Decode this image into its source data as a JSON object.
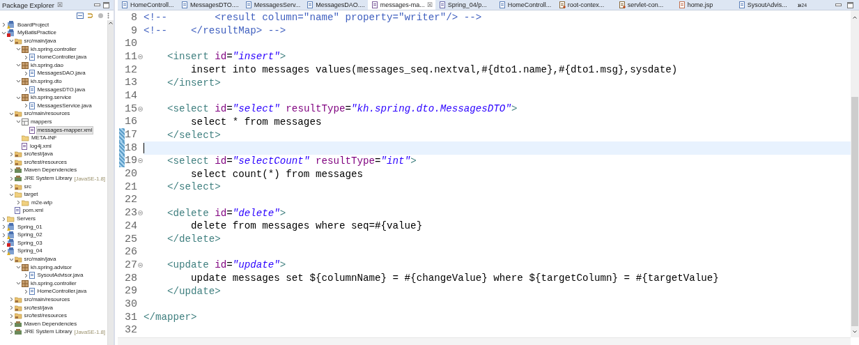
{
  "explorer": {
    "title": "Package Explorer",
    "close": "☒",
    "tree": [
      {
        "label": "BoardProject",
        "kind": "project",
        "error": false,
        "expanded": false,
        "selected": false
      },
      {
        "label": "MyBatisPractice",
        "kind": "project",
        "error": true,
        "expanded": true,
        "selected": false,
        "children": [
          {
            "label": "src/main/java",
            "kind": "source",
            "expanded": true,
            "selected": false,
            "children": [
              {
                "label": "kh.spring.controller",
                "kind": "package",
                "expanded": true,
                "selected": false,
                "children": [
                  {
                    "label": "HomeController.java",
                    "kind": "java",
                    "expanded": false,
                    "selected": false
                  }
                ]
              },
              {
                "label": "kh.spring.dao",
                "kind": "package",
                "expanded": true,
                "selected": false,
                "children": [
                  {
                    "label": "MessagesDAO.java",
                    "kind": "java",
                    "expanded": false,
                    "selected": false
                  }
                ]
              },
              {
                "label": "kh.spring.dto",
                "kind": "package",
                "expanded": true,
                "selected": false,
                "children": [
                  {
                    "label": "MessagesDTO.java",
                    "kind": "java",
                    "expanded": false,
                    "selected": false
                  }
                ]
              },
              {
                "label": "kh.spring.service",
                "kind": "package",
                "expanded": true,
                "selected": false,
                "children": [
                  {
                    "label": "MessagesService.java",
                    "kind": "java",
                    "expanded": false,
                    "selected": false
                  }
                ]
              }
            ]
          },
          {
            "label": "src/main/resources",
            "kind": "source",
            "expanded": true,
            "selected": false,
            "children": [
              {
                "label": "mappers",
                "kind": "mappers",
                "expanded": true,
                "selected": false,
                "children": [
                  {
                    "label": "messages-mapper.xml",
                    "kind": "xml",
                    "selected": true
                  }
                ]
              },
              {
                "label": "META-INF",
                "kind": "folder",
                "selected": false
              },
              {
                "label": "log4j.xml",
                "kind": "xml",
                "selected": false
              }
            ]
          },
          {
            "label": "src/test/java",
            "kind": "source",
            "expanded": false,
            "selected": false
          },
          {
            "label": "src/test/resources",
            "kind": "source",
            "expanded": false,
            "selected": false
          },
          {
            "label": "Maven Dependencies",
            "kind": "library",
            "expanded": false,
            "selected": false
          },
          {
            "label": "JRE System Library",
            "decoration": "[JavaSE-1.8]",
            "kind": "library",
            "expanded": false,
            "selected": false
          },
          {
            "label": "src",
            "kind": "source",
            "expanded": false,
            "selected": false
          },
          {
            "label": "target",
            "kind": "folder",
            "expanded": true,
            "selected": false,
            "children": [
              {
                "label": "m2e-wtp",
                "kind": "folder",
                "expanded": false,
                "selected": false
              }
            ]
          },
          {
            "label": "pom.xml",
            "kind": "pom",
            "selected": false
          }
        ]
      },
      {
        "label": "Servers",
        "kind": "folder",
        "expanded": false,
        "selected": false
      },
      {
        "label": "Spring_01",
        "kind": "project",
        "error": false,
        "expanded": false,
        "selected": false
      },
      {
        "label": "Spring_02",
        "kind": "project",
        "error": false,
        "expanded": false,
        "selected": false
      },
      {
        "label": "Spring_03",
        "kind": "project",
        "error": true,
        "expanded": false,
        "selected": false
      },
      {
        "label": "Spring_04",
        "kind": "project",
        "error": false,
        "expanded": true,
        "selected": false,
        "children": [
          {
            "label": "src/main/java",
            "kind": "source",
            "expanded": true,
            "selected": false,
            "children": [
              {
                "label": "kh.spring.advisor",
                "kind": "package",
                "expanded": true,
                "selected": false,
                "children": [
                  {
                    "label": "SysoutAdvisor.java",
                    "kind": "java",
                    "expanded": false,
                    "selected": false
                  }
                ]
              },
              {
                "label": "kh.spring.controller",
                "kind": "package",
                "expanded": true,
                "selected": false,
                "children": [
                  {
                    "label": "HomeController.java",
                    "kind": "java",
                    "expanded": false,
                    "selected": false
                  }
                ]
              }
            ]
          },
          {
            "label": "src/main/resources",
            "kind": "source",
            "expanded": false,
            "selected": false
          },
          {
            "label": "src/test/java",
            "kind": "source",
            "expanded": false,
            "selected": false
          },
          {
            "label": "src/test/resources",
            "kind": "source",
            "expanded": false,
            "selected": false
          },
          {
            "label": "Maven Dependencies",
            "kind": "library",
            "expanded": false,
            "selected": false
          },
          {
            "label": "JRE System Library",
            "decoration": "[JavaSE-1.8]",
            "kind": "library",
            "expanded": false,
            "selected": false
          }
        ]
      }
    ]
  },
  "editor": {
    "tabs": [
      {
        "label": "HomeControll...",
        "kind": "java",
        "selected": false
      },
      {
        "label": "MessagesDTO....",
        "kind": "java",
        "selected": false
      },
      {
        "label": "MessagesServ...",
        "kind": "java",
        "selected": false
      },
      {
        "label": "MessagesDAO....",
        "kind": "java",
        "selected": false
      },
      {
        "label": "messages-ma...",
        "kind": "xml",
        "selected": true,
        "close": "☒"
      },
      {
        "label": "Spring_04/p...",
        "kind": "pom",
        "selected": false
      },
      {
        "label": "HomeControll...",
        "kind": "java",
        "selected": false
      },
      {
        "label": "root-contex...",
        "kind": "spring",
        "selected": false
      },
      {
        "label": "servlet-con...",
        "kind": "spring",
        "selected": false
      },
      {
        "label": "home.jsp",
        "kind": "jsp",
        "selected": false
      },
      {
        "label": "SysoutAdvis...",
        "kind": "java",
        "selected": false
      }
    ],
    "overflow": "»",
    "overflow_count": "24",
    "lines": [
      {
        "number": "8",
        "segments": [
          {
            "kind": "comment",
            "text": "<!--        <result column=\"name\" property=\"writer\"/> -->"
          }
        ]
      },
      {
        "number": "9",
        "segments": [
          {
            "kind": "comment",
            "text": "<!--    </resultMap> -->"
          }
        ]
      },
      {
        "number": "10"
      },
      {
        "number": "11",
        "fold": true,
        "segments": [
          {
            "kind": "tag",
            "text": "    <insert"
          },
          {
            "kind": "attr",
            "text": " id"
          },
          {
            "kind": "text",
            "text": "="
          },
          {
            "kind": "string",
            "text": "\"insert\""
          },
          {
            "kind": "tag",
            "text": ">"
          }
        ]
      },
      {
        "number": "12",
        "segments": [
          {
            "kind": "text",
            "text": "        insert into messages values(messages_seq.nextval,#{dto1.name},#{dto1.msg},sysdate)"
          }
        ]
      },
      {
        "number": "13",
        "segments": [
          {
            "kind": "tag",
            "text": "    </insert>"
          }
        ]
      },
      {
        "number": "14"
      },
      {
        "number": "15",
        "fold": true,
        "segments": [
          {
            "kind": "tag",
            "text": "    <select"
          },
          {
            "kind": "attr",
            "text": " id"
          },
          {
            "kind": "text",
            "text": "="
          },
          {
            "kind": "string",
            "text": "\"select\""
          },
          {
            "kind": "attr",
            "text": " resultType"
          },
          {
            "kind": "text",
            "text": "="
          },
          {
            "kind": "string",
            "text": "\"kh.spring.dto.MessagesDTO\""
          },
          {
            "kind": "tag",
            "text": ">"
          }
        ]
      },
      {
        "number": "16",
        "segments": [
          {
            "kind": "text",
            "text": "        select * from messages"
          }
        ]
      },
      {
        "number": "17",
        "changed": true,
        "segments": [
          {
            "kind": "tag",
            "text": "    </select>"
          }
        ]
      },
      {
        "number": "18",
        "changed": true,
        "current": true
      },
      {
        "number": "19",
        "changed": true,
        "fold": true,
        "segments": [
          {
            "kind": "tag",
            "text": "    <select"
          },
          {
            "kind": "attr",
            "text": " id"
          },
          {
            "kind": "text",
            "text": "="
          },
          {
            "kind": "string",
            "text": "\"selectCount\""
          },
          {
            "kind": "attr",
            "text": " resultType"
          },
          {
            "kind": "text",
            "text": "="
          },
          {
            "kind": "string",
            "text": "\"int\""
          },
          {
            "kind": "tag",
            "text": ">"
          }
        ]
      },
      {
        "number": "20",
        "segments": [
          {
            "kind": "text",
            "text": "        select count(*) from messages"
          }
        ]
      },
      {
        "number": "21",
        "segments": [
          {
            "kind": "tag",
            "text": "    </select>"
          }
        ]
      },
      {
        "number": "22"
      },
      {
        "number": "23",
        "fold": true,
        "segments": [
          {
            "kind": "tag",
            "text": "    <delete"
          },
          {
            "kind": "attr",
            "text": " id"
          },
          {
            "kind": "text",
            "text": "="
          },
          {
            "kind": "string",
            "text": "\"delete\""
          },
          {
            "kind": "tag",
            "text": ">"
          }
        ]
      },
      {
        "number": "24",
        "segments": [
          {
            "kind": "text",
            "text": "        delete from messages where seq=#{value}"
          }
        ]
      },
      {
        "number": "25",
        "segments": [
          {
            "kind": "tag",
            "text": "    </delete>"
          }
        ]
      },
      {
        "number": "26"
      },
      {
        "number": "27",
        "fold": true,
        "segments": [
          {
            "kind": "tag",
            "text": "    <update"
          },
          {
            "kind": "attr",
            "text": " id"
          },
          {
            "kind": "text",
            "text": "="
          },
          {
            "kind": "string",
            "text": "\"update\""
          },
          {
            "kind": "tag",
            "text": ">"
          }
        ]
      },
      {
        "number": "28",
        "segments": [
          {
            "kind": "text",
            "text": "        update messages set ${columnName} = #{changeValue} where ${targetColumn} = #{targetValue}"
          }
        ]
      },
      {
        "number": "29",
        "segments": [
          {
            "kind": "tag",
            "text": "    </update>"
          }
        ]
      },
      {
        "number": "30"
      },
      {
        "number": "31",
        "segments": [
          {
            "kind": "tag",
            "text": "</mapper>"
          }
        ]
      },
      {
        "number": "32"
      }
    ]
  }
}
